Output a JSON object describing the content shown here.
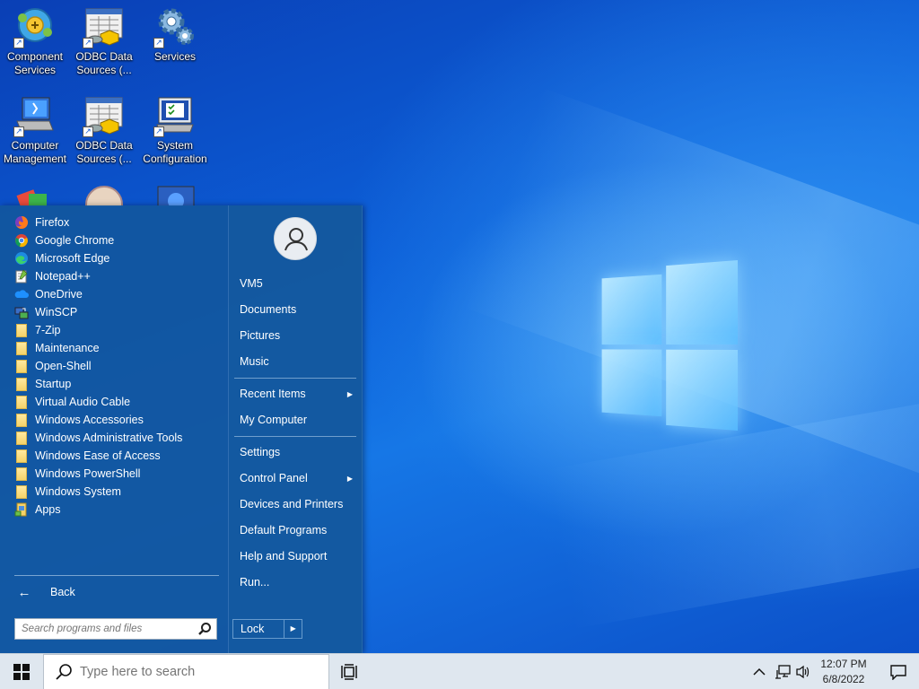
{
  "desktop": {
    "icons": [
      {
        "label": "Component Services",
        "icon": "component-services-icon"
      },
      {
        "label": "ODBC Data Sources (...",
        "icon": "odbc-icon"
      },
      {
        "label": "Services",
        "icon": "gears-icon"
      },
      {
        "label": "Computer Management",
        "icon": "computer-management-icon"
      },
      {
        "label": "ODBC Data Sources (...",
        "icon": "odbc-icon"
      },
      {
        "label": "System Configuration",
        "icon": "system-configuration-icon"
      }
    ]
  },
  "start_menu": {
    "programs": [
      {
        "label": "Firefox",
        "icon": "firefox-icon"
      },
      {
        "label": "Google Chrome",
        "icon": "chrome-icon"
      },
      {
        "label": "Microsoft Edge",
        "icon": "edge-icon"
      },
      {
        "label": "Notepad++",
        "icon": "notepadpp-icon"
      },
      {
        "label": "OneDrive",
        "icon": "onedrive-icon"
      },
      {
        "label": "WinSCP",
        "icon": "winscp-icon"
      },
      {
        "label": "7-Zip",
        "icon": "folder-icon"
      },
      {
        "label": "Maintenance",
        "icon": "folder-icon"
      },
      {
        "label": "Open-Shell",
        "icon": "folder-icon"
      },
      {
        "label": "Startup",
        "icon": "folder-icon"
      },
      {
        "label": "Virtual Audio Cable",
        "icon": "folder-icon"
      },
      {
        "label": "Windows Accessories",
        "icon": "folder-icon"
      },
      {
        "label": "Windows Administrative Tools",
        "icon": "folder-icon"
      },
      {
        "label": "Windows Ease of Access",
        "icon": "folder-icon"
      },
      {
        "label": "Windows PowerShell",
        "icon": "folder-icon"
      },
      {
        "label": "Windows System",
        "icon": "folder-icon"
      },
      {
        "label": "Apps",
        "icon": "apps-icon"
      }
    ],
    "back_label": "Back",
    "search_placeholder": "Search programs and files",
    "right_items": {
      "user": "VM5",
      "documents": "Documents",
      "pictures": "Pictures",
      "music": "Music",
      "recent_items": "Recent Items",
      "my_computer": "My Computer",
      "settings": "Settings",
      "control_panel": "Control Panel",
      "devices_printers": "Devices and Printers",
      "default_programs": "Default Programs",
      "help_support": "Help and Support",
      "run": "Run..."
    },
    "lock_label": "Lock"
  },
  "taskbar": {
    "search_placeholder": "Type here to search",
    "time": "12:07 PM",
    "date": "6/8/2022"
  },
  "colors": {
    "menu_bg": "#12569e",
    "taskbar_bg": "#dfe7ef",
    "wallpaper_accent": "#1677e6"
  }
}
